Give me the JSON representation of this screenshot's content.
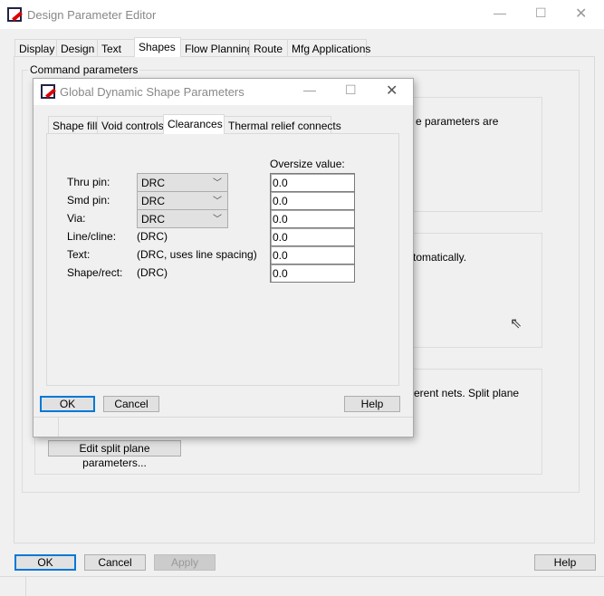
{
  "main": {
    "title": "Design Parameter Editor",
    "tabs": [
      "Display",
      "Design",
      "Text",
      "Shapes",
      "Flow Planning",
      "Route",
      "Mfg Applications"
    ],
    "group_title": "Command parameters",
    "group1_text": "e parameters are",
    "group2_text": "tomatically.",
    "group3_text": "erent nets.  Split plane",
    "edit_split_button": "Edit split plane parameters...",
    "ok": "OK",
    "cancel": "Cancel",
    "apply": "Apply",
    "help": "Help"
  },
  "dialog": {
    "title": "Global Dynamic Shape Parameters",
    "tabs": [
      "Shape fill",
      "Void controls",
      "Clearances",
      "Thermal relief connects"
    ],
    "oversize_header": "Oversize value:",
    "rows": [
      {
        "label": "Thru pin:",
        "value": "DRC",
        "oversize": "0.0"
      },
      {
        "label": "Smd pin:",
        "value": "DRC",
        "oversize": "0.0"
      },
      {
        "label": "Via:",
        "value": "DRC",
        "oversize": "0.0"
      },
      {
        "label": "Line/cline:",
        "value": "(DRC)",
        "oversize": "0.0"
      },
      {
        "label": "Text:",
        "value": "(DRC, uses line spacing)",
        "oversize": "0.0"
      },
      {
        "label": "Shape/rect:",
        "value": "(DRC)",
        "oversize": "0.0"
      }
    ],
    "ok": "OK",
    "cancel": "Cancel",
    "help": "Help"
  }
}
